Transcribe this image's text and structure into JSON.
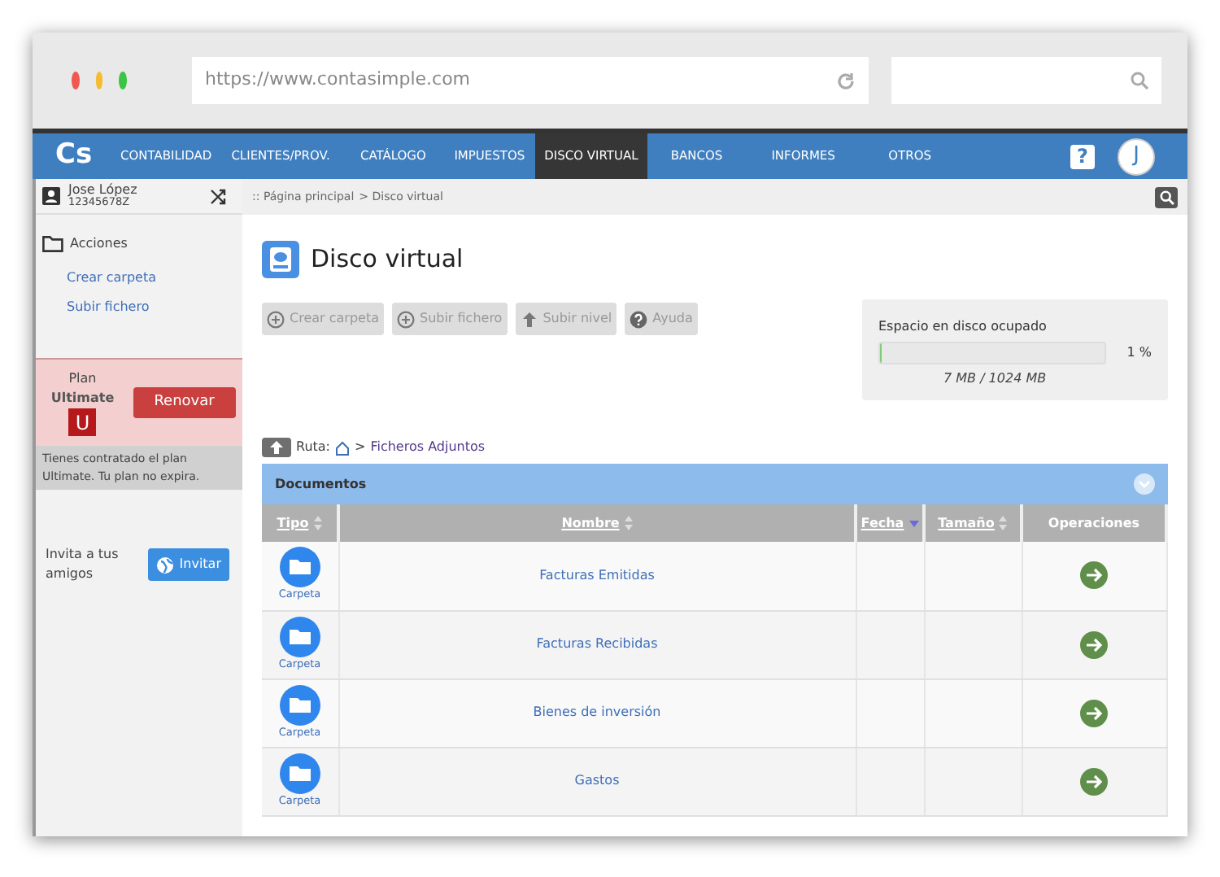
{
  "browser": {
    "url": "https://www.contasimple.com"
  },
  "navbar": {
    "logo": "Cs",
    "items": [
      {
        "label": "CONTABILIDAD",
        "selected": false
      },
      {
        "label": "CLIENTES/PROV.",
        "selected": false
      },
      {
        "label": "CATÁLOGO",
        "selected": false
      },
      {
        "label": "IMPUESTOS",
        "selected": false
      },
      {
        "label": "DISCO VIRTUAL",
        "selected": true
      },
      {
        "label": "BANCOS",
        "selected": false
      },
      {
        "label": "INFORMES",
        "selected": false
      },
      {
        "label": "OTROS",
        "selected": false
      }
    ],
    "help": "?",
    "avatar": "J"
  },
  "sidebar": {
    "user": {
      "name": "Jose López",
      "id": "12345678Z"
    },
    "section": "Acciones",
    "actions": [
      "Crear carpeta",
      "Subir fichero"
    ],
    "plan": {
      "label": "Plan",
      "name": "Ultimate",
      "badge": "U",
      "button": "Renovar",
      "info": "Tienes contratado el plan Ultimate. Tu plan no expira."
    },
    "invite": {
      "text": "Invita a tus amigos",
      "button": "Invitar"
    }
  },
  "breadcrumb": {
    "home": ":: Página principal",
    "current": "> Disco virtual"
  },
  "page_title": "Disco virtual",
  "toolbar": [
    {
      "label": "Crear carpeta",
      "kind": "plus"
    },
    {
      "label": "Subir fichero",
      "kind": "plus"
    },
    {
      "label": "Subir nivel",
      "kind": "up"
    },
    {
      "label": "Ayuda",
      "kind": "help"
    }
  ],
  "disk": {
    "label": "Espacio en disco ocupado",
    "level": 0.01,
    "percent": "1 %",
    "detail": "7 MB / 1024 MB"
  },
  "path": {
    "label": "Ruta:",
    "separator": ">",
    "folder": "Ficheros Adjuntos"
  },
  "table": {
    "title": "Documentos",
    "columns": [
      {
        "label": "Tipo",
        "sortable": true,
        "sorted": false
      },
      {
        "label": "Nombre",
        "sortable": true,
        "sorted": false
      },
      {
        "label": "Fecha",
        "sortable": true,
        "sorted": true
      },
      {
        "label": "Tamaño",
        "sortable": true,
        "sorted": false
      },
      {
        "label": "Operaciones",
        "sortable": false,
        "sorted": false
      }
    ],
    "rows": [
      {
        "type": "Carpeta",
        "name": "Facturas Emitidas"
      },
      {
        "type": "Carpeta",
        "name": "Facturas Recibidas"
      },
      {
        "type": "Carpeta",
        "name": "Bienes de inversión"
      },
      {
        "type": "Carpeta",
        "name": "Gastos"
      }
    ]
  }
}
